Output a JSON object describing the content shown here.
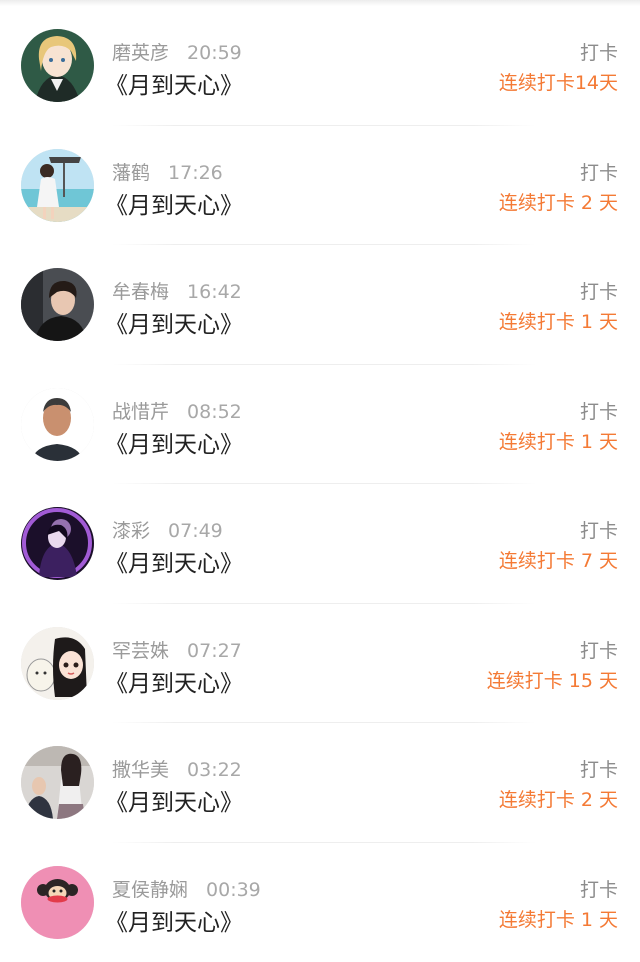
{
  "items": [
    {
      "name": "磨英彦",
      "time": "20:59",
      "book": "《月到天心》",
      "action": "打卡",
      "streak": "连续打卡14天",
      "avatar": "anime-blonde-avatar"
    },
    {
      "name": "藩鹤",
      "time": "17:26",
      "book": "《月到天心》",
      "action": "打卡",
      "streak": "连续打卡 2 天",
      "avatar": "beach-girl-avatar"
    },
    {
      "name": "牟春梅",
      "time": "16:42",
      "book": "《月到天心》",
      "action": "打卡",
      "streak": "连续打卡 1 天",
      "avatar": "young-man-avatar"
    },
    {
      "name": "战惜芹",
      "time": "08:52",
      "book": "《月到天心》",
      "action": "打卡",
      "streak": "连续打卡 1 天",
      "avatar": "older-man-avatar"
    },
    {
      "name": "漆彩",
      "time": "07:49",
      "book": "《月到天心》",
      "action": "打卡",
      "streak": "连续打卡 7 天",
      "avatar": "purple-anime-avatar"
    },
    {
      "name": "罕芸姝",
      "time": "07:27",
      "book": "《月到天心》",
      "action": "打卡",
      "streak": "连续打卡 15 天",
      "avatar": "cartoon-girl-avatar"
    },
    {
      "name": "撒华美",
      "time": "03:22",
      "book": "《月到天心》",
      "action": "打卡",
      "streak": "连续打卡 2 天",
      "avatar": "couple-photo-avatar"
    },
    {
      "name": "夏侯静娴",
      "time": "00:39",
      "book": "《月到天心》",
      "action": "打卡",
      "streak": "连续打卡 1 天",
      "avatar": "monkey-logo-avatar"
    }
  ],
  "colors": {
    "streak": "#f47a35",
    "name": "#9a9a9a",
    "book": "#222222"
  }
}
